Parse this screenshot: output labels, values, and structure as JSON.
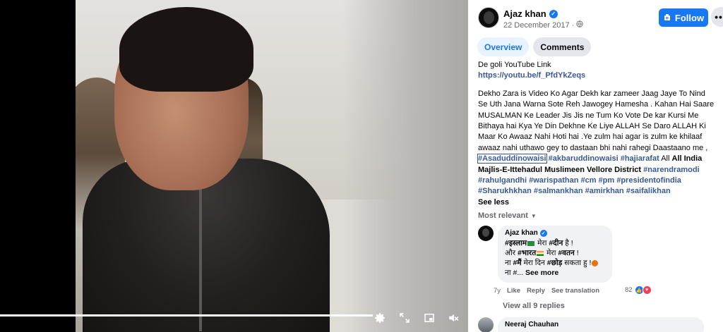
{
  "video": {
    "progress_percent": 100,
    "controls": [
      {
        "icon": "settings-icon"
      },
      {
        "icon": "fullscreen-icon"
      },
      {
        "icon": "picture-in-picture-icon"
      },
      {
        "icon": "volume-muted-icon"
      }
    ]
  },
  "post": {
    "author": "Ajaz khan",
    "date": "22 December 2017 ·",
    "follow_label": "Follow",
    "more_label": "•••",
    "tabs": [
      {
        "label": "Overview",
        "active": true
      },
      {
        "label": "Comments",
        "active": false
      }
    ],
    "text_line1": "De goli YouTube Link",
    "link": "https://youtu.be/f_PfdYkZeqs",
    "body": "Dekho Zara is Video Ko Agar Dekh kar zameer Jaag Jaye To Nind Se Uth Jana Warna Sote Reh Jawogey Hamesha . Kahan Hai Saare MUSALMAN Ke Leader Jis Jis ne Tum Ko Vote De kar Kursi Me Bithaya hai Kya Ye Din Dekhne Ke Liye ALLAH Se Daro ALLAH Ki Maar Ko Awaaz Nahi Hoti hai .Ye zulm hai agar is zulm ke khilaaf awaaz nahi uthawo gey to dastaan bhi nahi rahegi Daastaano me ,",
    "hashtag_highlight": "#Asaduddinowaisi",
    "hashtags_rest": "#akbaruddinowaisi #hajiarafat",
    "all_word": "All",
    "org": "All India Majlis-E-Ittehadul Muslimeen Vellore District",
    "hashtags_end": "#narendramodi #rahulgandhi #warispathan #cm #pm #presidentofindia #Sharukhkhan #salmankhan #amirkhan #saifalikhan",
    "see_less": "See less"
  },
  "comments_section": {
    "sort_label": "Most relevant",
    "comment": {
      "author": "Ajaz khan",
      "line1_tag": "#इस्लाम",
      "line1_rest": " मेरा ",
      "line1_tag2": "#दीन",
      "line1_end": " है !",
      "line2_start": "और ",
      "line2_tag": "#भारत",
      "line2_mid": " मेरा ",
      "line2_tag2": "#वतन",
      "line2_end": " !",
      "line3_start": "ना ",
      "line3_tag": "#मैं",
      "line3_mid": " मेरा दिन ",
      "line3_tag2": "#छोड़",
      "line3_end": " सकता हु !",
      "line4_start": "ना #...",
      "see_more": "See more",
      "age": "7y",
      "like": "Like",
      "reply": "Reply",
      "translate": "See translation",
      "reaction_count": "82"
    },
    "view_replies": "View all 9 replies",
    "comment2_author": "Neeraj Chauhan"
  }
}
